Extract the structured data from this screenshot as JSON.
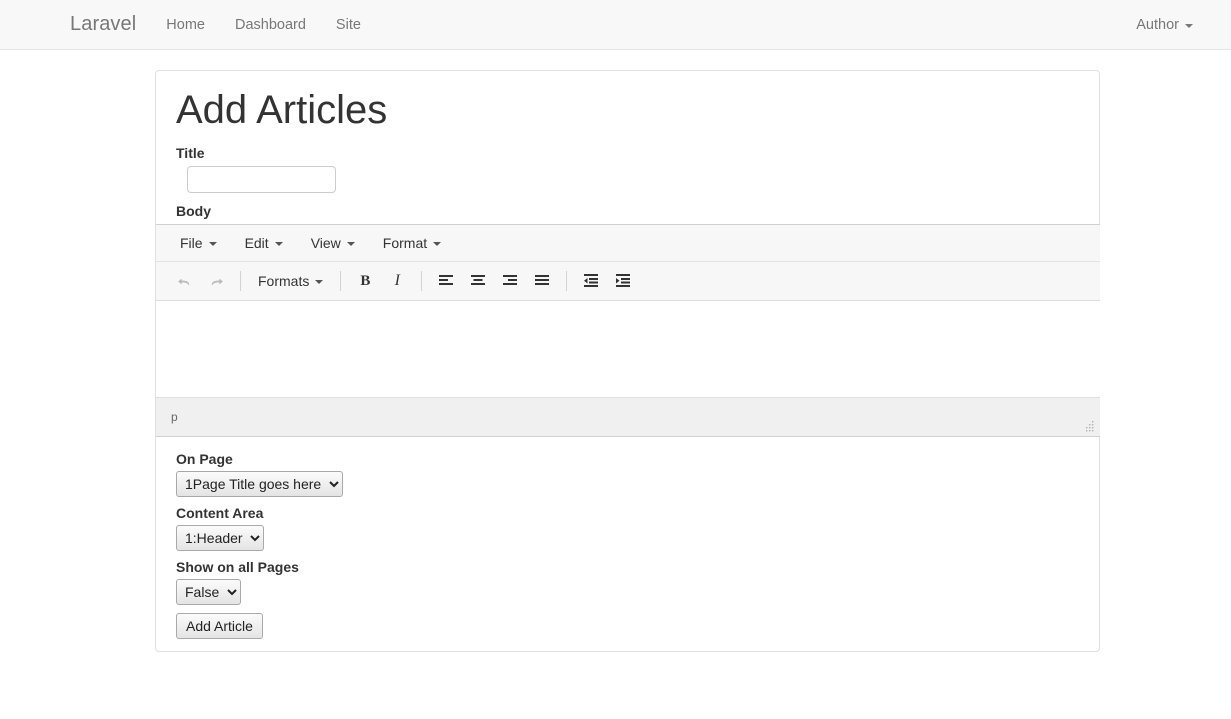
{
  "navbar": {
    "brand": "Laravel",
    "links": [
      {
        "label": "Home"
      },
      {
        "label": "Dashboard"
      },
      {
        "label": "Site"
      }
    ],
    "user_menu": {
      "label": "Author"
    }
  },
  "page": {
    "title": "Add Articles"
  },
  "form": {
    "title_label": "Title",
    "title_value": "",
    "body_label": "Body",
    "on_page_label": "On Page",
    "on_page_value": "1Page Title goes here",
    "content_area_label": "Content Area",
    "content_area_value": "1:Header",
    "show_all_label": "Show on all Pages",
    "show_all_value": "False",
    "submit_label": "Add Article"
  },
  "editor": {
    "menubar": [
      {
        "label": "File"
      },
      {
        "label": "Edit"
      },
      {
        "label": "View"
      },
      {
        "label": "Format"
      }
    ],
    "toolbar": {
      "undo": "undo-icon",
      "redo": "redo-icon",
      "formats_label": "Formats",
      "bold": "B",
      "italic": "I",
      "align_left": "align-left-icon",
      "align_center": "align-center-icon",
      "align_right": "align-right-icon",
      "align_justify": "align-justify-icon",
      "outdent": "outdent-icon",
      "indent": "indent-icon"
    },
    "content": "",
    "statusbar_path": "p",
    "resize_handle": "resize-grip-icon"
  },
  "colors": {
    "navbar_bg": "#f8f8f8",
    "navbar_border": "#e7e7e7",
    "text_muted": "#777777",
    "panel_border": "#e0e0e0",
    "toolbar_bg": "#f7f7f7",
    "statusbar_bg": "#f0f0f0"
  }
}
